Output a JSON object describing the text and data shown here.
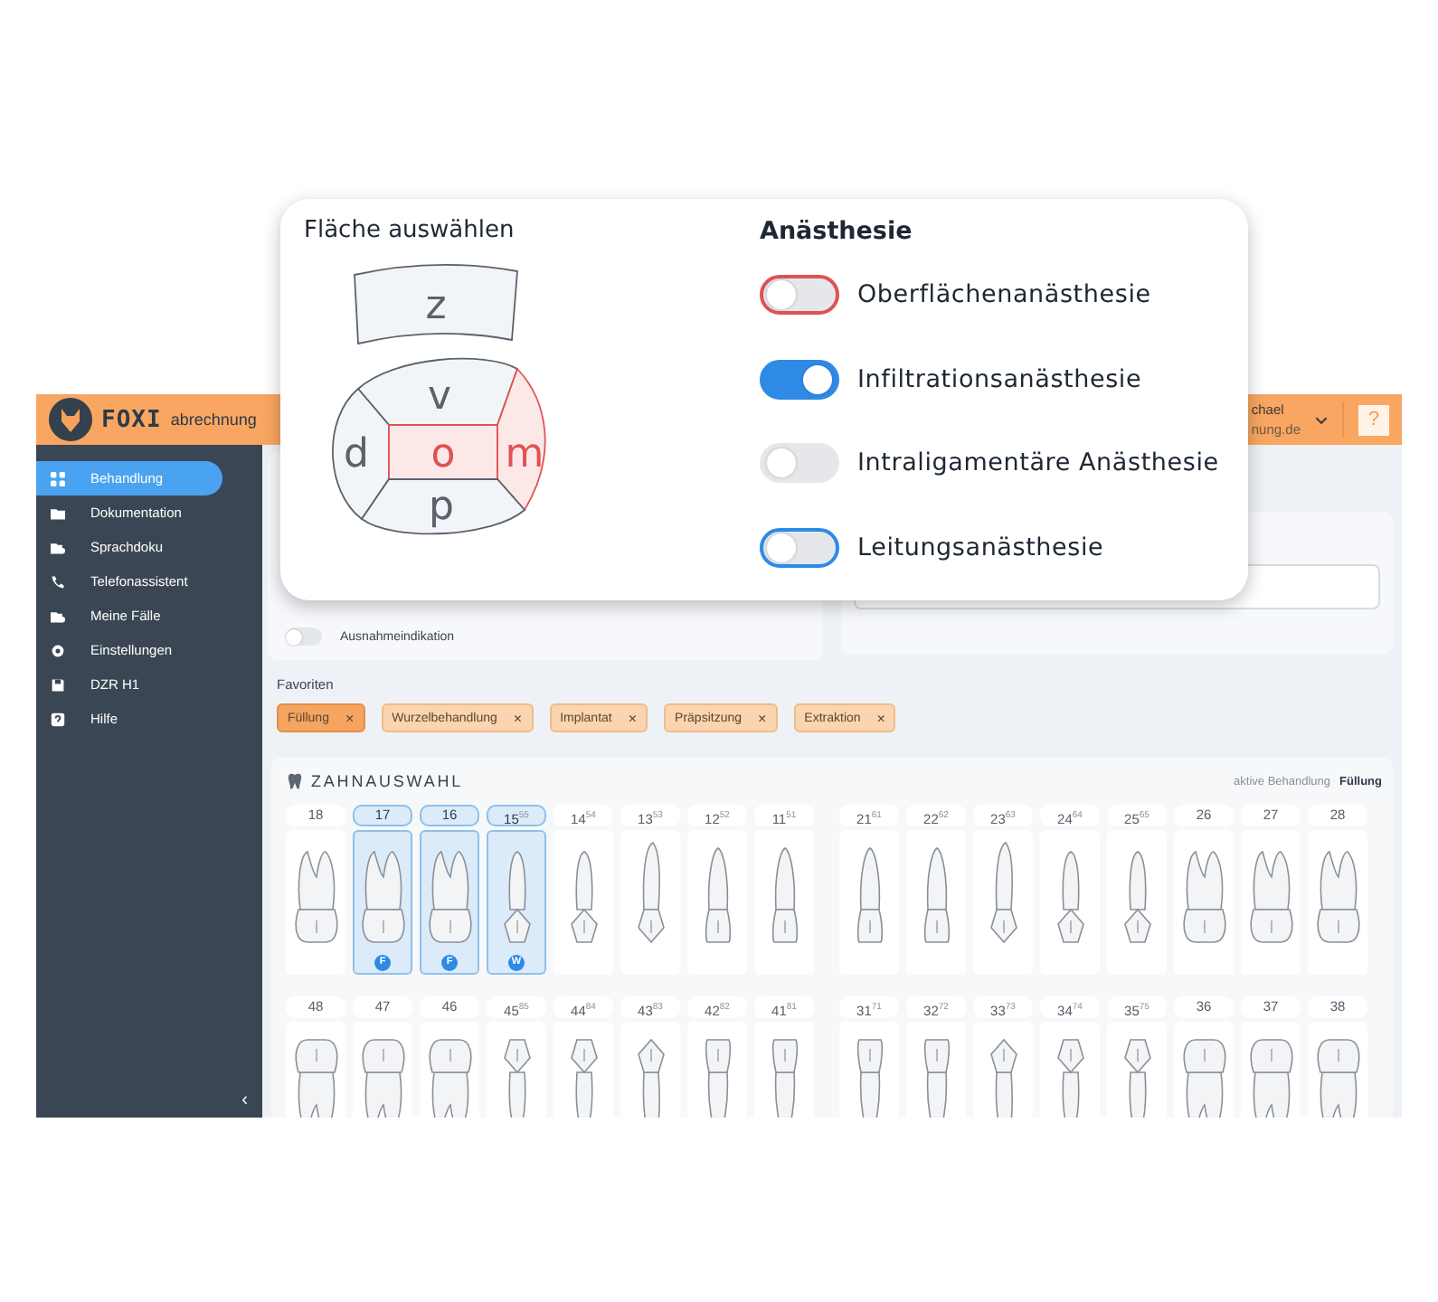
{
  "header": {
    "brand": "FOXI",
    "product": "abrechnung",
    "user_name": "chael",
    "user_email": "nung.de",
    "help": "?"
  },
  "sidebar": {
    "items": [
      {
        "label": "Behandlung",
        "kind": "grid",
        "selected": true
      },
      {
        "label": "Dokumentation",
        "kind": "folder",
        "selected": false
      },
      {
        "label": "Sprachdoku",
        "kind": "media",
        "selected": false
      },
      {
        "label": "Telefonassistent",
        "kind": "phone",
        "selected": false
      },
      {
        "label": "Meine Fälle",
        "kind": "cases",
        "selected": false
      },
      {
        "label": "Einstellungen",
        "kind": "gear",
        "selected": false
      },
      {
        "label": "DZR H1",
        "kind": "disk",
        "selected": false
      },
      {
        "label": "Hilfe",
        "kind": "help",
        "selected": false
      }
    ],
    "collapse": "‹"
  },
  "exception": {
    "label": "Ausnahmeindikation",
    "on": false
  },
  "favorites": {
    "title": "Favoriten",
    "chips": [
      {
        "label": "Füllung",
        "selected": true
      },
      {
        "label": "Wurzelbehandlung",
        "selected": false
      },
      {
        "label": "Implantat",
        "selected": false
      },
      {
        "label": "Präpsitzung",
        "selected": false
      },
      {
        "label": "Extraktion",
        "selected": false
      }
    ],
    "remove": "×"
  },
  "tooth_chart": {
    "title": "ZAHNAUSWAHL",
    "active_label": "aktive Behandlung",
    "active_value": "Füllung",
    "rows": [
      {
        "kind": "upper",
        "left": [
          {
            "number": "18",
            "kind": "molar",
            "selected": false
          },
          {
            "number": "17",
            "kind": "molar",
            "selected": true,
            "badge": "F"
          },
          {
            "number": "16",
            "kind": "molar",
            "selected": true,
            "badge": "F"
          },
          {
            "number": "15",
            "deciduous": "55",
            "kind": "premolar",
            "selected": true,
            "badge": "W"
          },
          {
            "number": "14",
            "deciduous": "54",
            "kind": "premolar",
            "selected": false
          },
          {
            "number": "13",
            "deciduous": "53",
            "kind": "canine",
            "selected": false
          },
          {
            "number": "12",
            "deciduous": "52",
            "kind": "incisor",
            "selected": false
          },
          {
            "number": "11",
            "deciduous": "51",
            "kind": "incisor",
            "selected": false
          }
        ],
        "right": [
          {
            "number": "21",
            "deciduous": "61",
            "kind": "incisor",
            "selected": false
          },
          {
            "number": "22",
            "deciduous": "62",
            "kind": "incisor",
            "selected": false
          },
          {
            "number": "23",
            "deciduous": "63",
            "kind": "canine",
            "selected": false
          },
          {
            "number": "24",
            "deciduous": "64",
            "kind": "premolar",
            "selected": false
          },
          {
            "number": "25",
            "deciduous": "65",
            "kind": "premolar",
            "selected": false
          },
          {
            "number": "26",
            "kind": "molar",
            "selected": false
          },
          {
            "number": "27",
            "kind": "molar",
            "selected": false
          },
          {
            "number": "28",
            "kind": "molar",
            "selected": false
          }
        ]
      },
      {
        "kind": "lower",
        "left": [
          {
            "number": "48",
            "kind": "molar",
            "selected": false
          },
          {
            "number": "47",
            "kind": "molar",
            "selected": false
          },
          {
            "number": "46",
            "kind": "molar",
            "selected": false
          },
          {
            "number": "45",
            "deciduous": "85",
            "kind": "premolar",
            "selected": false
          },
          {
            "number": "44",
            "deciduous": "84",
            "kind": "premolar",
            "selected": false
          },
          {
            "number": "43",
            "deciduous": "83",
            "kind": "canine",
            "selected": false
          },
          {
            "number": "42",
            "deciduous": "82",
            "kind": "incisor",
            "selected": false
          },
          {
            "number": "41",
            "deciduous": "81",
            "kind": "incisor",
            "selected": false
          }
        ],
        "right": [
          {
            "number": "31",
            "deciduous": "71",
            "kind": "incisor",
            "selected": false
          },
          {
            "number": "32",
            "deciduous": "72",
            "kind": "incisor",
            "selected": false
          },
          {
            "number": "33",
            "deciduous": "73",
            "kind": "canine",
            "selected": false
          },
          {
            "number": "34",
            "deciduous": "74",
            "kind": "premolar",
            "selected": false
          },
          {
            "number": "35",
            "deciduous": "75",
            "kind": "premolar",
            "selected": false
          },
          {
            "number": "36",
            "kind": "molar",
            "selected": false
          },
          {
            "number": "37",
            "kind": "molar",
            "selected": false
          },
          {
            "number": "38",
            "kind": "molar",
            "selected": false
          }
        ]
      }
    ]
  },
  "popup": {
    "surface_title": "Fläche auswählen",
    "surfaces": [
      {
        "label": "z",
        "kind": "incisal",
        "selected": false
      },
      {
        "label": "v",
        "kind": "vestibular",
        "selected": false
      },
      {
        "label": "d",
        "kind": "distal",
        "selected": false
      },
      {
        "label": "o",
        "kind": "occlusal",
        "selected": true
      },
      {
        "label": "m",
        "kind": "mesial",
        "selected": true
      },
      {
        "label": "p",
        "kind": "palatal",
        "selected": false
      }
    ],
    "anesthesia_title": "Anästhesie",
    "options": [
      {
        "label": "Oberflächenanästhesie",
        "on": false,
        "color": "#e05252"
      },
      {
        "label": "Infiltrationsanästhesie",
        "on": true
      },
      {
        "label": "Intraligamentäre Anästhesie",
        "on": false
      },
      {
        "label": "Leitungsanästhesie",
        "on": false,
        "color": "#2f8ae6"
      }
    ]
  }
}
